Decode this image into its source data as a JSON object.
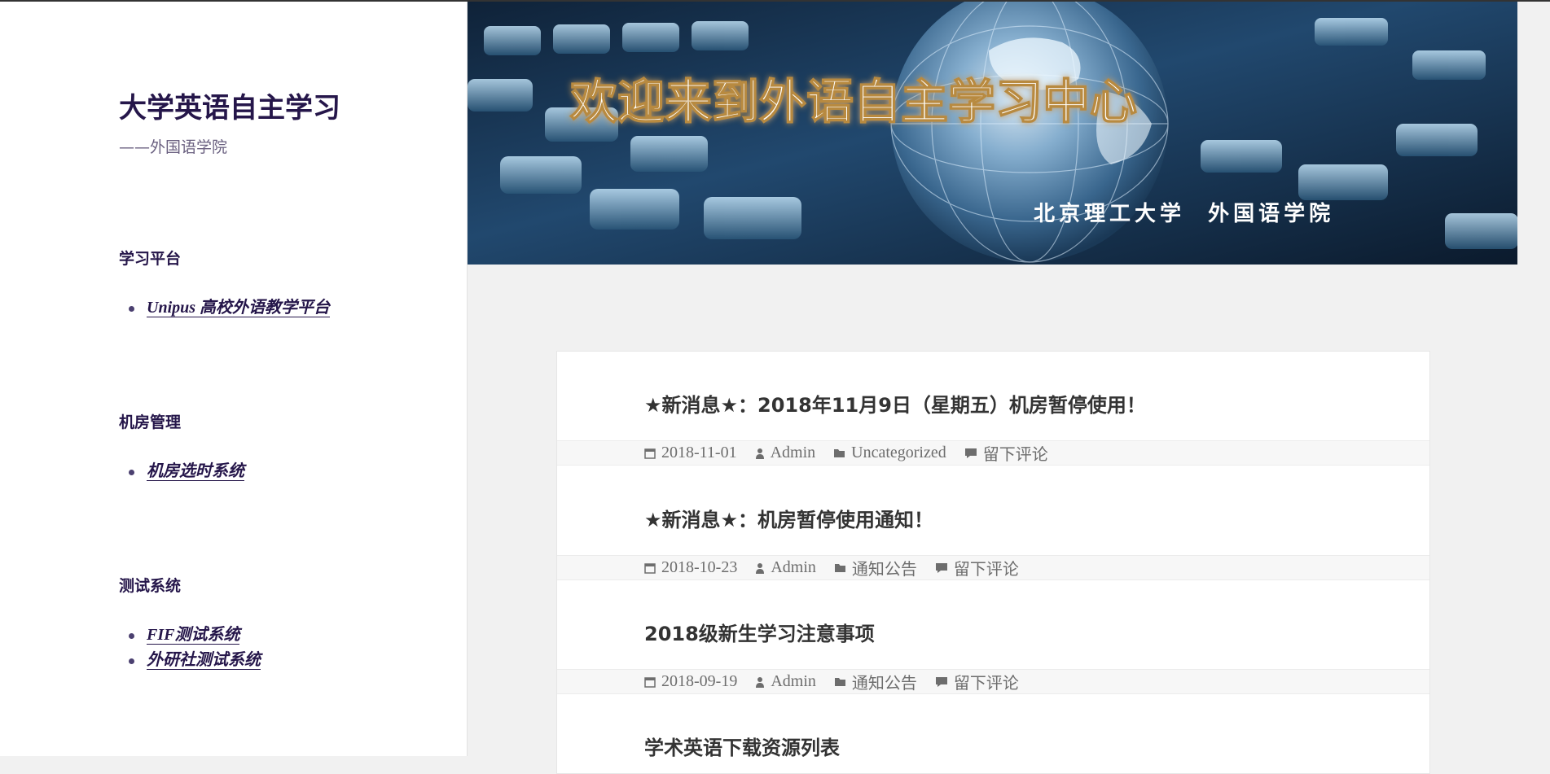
{
  "site": {
    "title": "大学英语自主学习",
    "description": "——外国语学院"
  },
  "banner": {
    "headline": "欢迎来到外语自主学习中心",
    "subline": "北京理工大学  外国语学院"
  },
  "widgets": [
    {
      "title": "学习平台",
      "links": [
        "Unipus 高校外语教学平台"
      ]
    },
    {
      "title": "机房管理",
      "links": [
        "机房选时系统"
      ]
    },
    {
      "title": "测试系统",
      "links": [
        "FIF测试系统",
        "外研社测试系统"
      ]
    }
  ],
  "posts": [
    {
      "title": "★新消息★：2018年11月9日（星期五）机房暂停使用！",
      "date": "2018-11-01",
      "author": "Admin",
      "category": "Uncategorized",
      "comments": "留下评论"
    },
    {
      "title": "★新消息★：机房暂停使用通知！",
      "date": "2018-10-23",
      "author": "Admin",
      "category": "通知公告",
      "comments": "留下评论"
    },
    {
      "title": "2018级新生学习注意事项",
      "date": "2018-09-19",
      "author": "Admin",
      "category": "通知公告",
      "comments": "留下评论"
    },
    {
      "title": "学术英语下载资源列表"
    }
  ],
  "icons": {
    "date": "calendar-icon",
    "author": "person-icon",
    "category": "folder-icon",
    "comments": "comment-icon"
  }
}
